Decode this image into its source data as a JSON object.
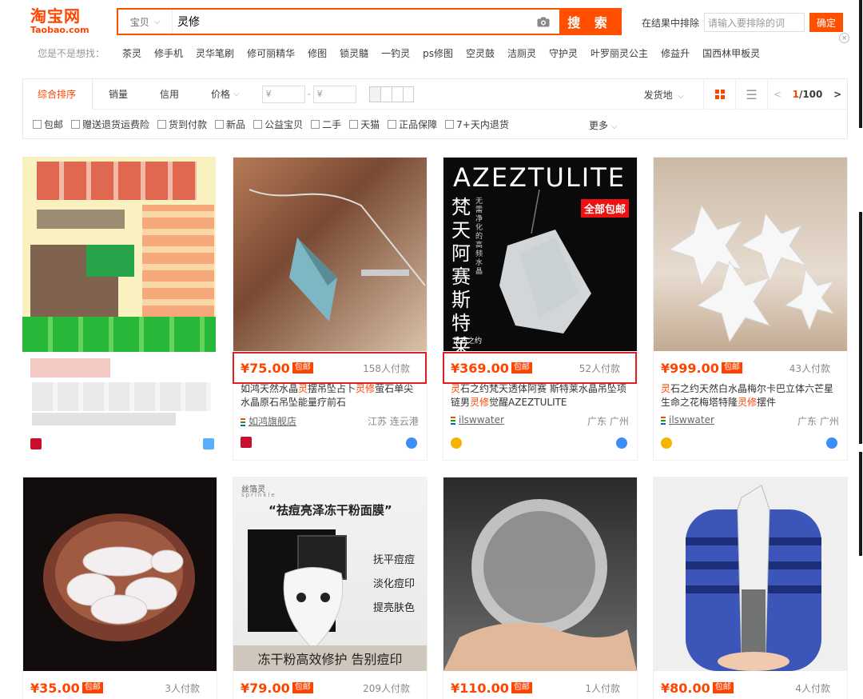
{
  "logo": {
    "cn": "淘宝网",
    "en": "Taobao.com"
  },
  "search": {
    "scope": "宝贝",
    "query": "灵修",
    "button": "搜 索"
  },
  "exclude": {
    "label": "在结果中排除",
    "placeholder": "请输入要排除的词",
    "ok": "确定"
  },
  "suggest": {
    "label": "您是不是想找：",
    "items": [
      "茶灵",
      "修手机",
      "灵华笔刷",
      "修可丽精华",
      "修图",
      "锁灵髓",
      "一钓灵",
      "ps修图",
      "空灵鼓",
      "洁厕灵",
      "守护灵",
      "叶罗丽灵公主",
      "修益升",
      "国西林甲板灵"
    ]
  },
  "sort": {
    "tabs": [
      "综合排序",
      "销量",
      "信用",
      "价格"
    ],
    "price_from": "¥",
    "price_to": "¥",
    "ship_from": "发货地",
    "page_current": "1",
    "page_total": "/100"
  },
  "filters": [
    "包邮",
    "赠送退货运费险",
    "货到付款",
    "新品",
    "公益宝贝",
    "二手",
    "天猫",
    "正品保障",
    "7+天内退货"
  ],
  "more": "更多",
  "products_row1": [
    {
      "price": "",
      "sales": "",
      "title": "",
      "shop": "",
      "loc": ""
    },
    {
      "price": "¥75.00",
      "badge": "包邮",
      "sales": "158人付款",
      "title_a": "如鸿天然水晶",
      "hl1": "灵",
      "title_b": "摆吊坠占卜",
      "hl2": "灵修",
      "title_c": "萤石单尖水晶原石吊坠能量疗前石",
      "shop": "如鸿旗舰店",
      "loc": "江苏 连云港"
    },
    {
      "price": "¥369.00",
      "badge": "包邮",
      "sales": "52人付款",
      "hl1": "灵",
      "title_a": "石之约梵天透体阿赛 斯特莱水晶吊坠项链男",
      "hl2": "灵修",
      "title_b": "觉醒AZEZTULITE",
      "shop": "ilswwater",
      "loc": "广东 广州",
      "img_title": "AZEZTULITE",
      "img_side": "梵天阿赛斯特莱",
      "img_tag": "全部包邮",
      "img_sub": "无需净化的高频水晶",
      "img_brand": "灵石之约"
    },
    {
      "price": "¥999.00",
      "badge": "包邮",
      "sales": "43人付款",
      "hl1": "灵",
      "title_a": "石之约天然白水晶梅尔卡巴立体六芒星生命之花梅塔特隆",
      "hl2": "灵修",
      "title_b": "摆件",
      "shop": "ilswwater",
      "loc": "广东 广州"
    }
  ],
  "products_row2": [
    {
      "price": "¥35.00",
      "badge": "包邮",
      "sales": "3人付款"
    },
    {
      "price": "¥79.00",
      "badge": "包邮",
      "sales": "209人付款",
      "img_brand": "丝箔灵",
      "img_brand_en": "sprinkle",
      "img_title": "“祛痘亮泽冻干粉面膜”",
      "img_points": [
        "抚平痘痘",
        "淡化痘印",
        "提亮肤色"
      ],
      "img_bottom": "冻干粉高效修护 告别痘印"
    },
    {
      "price": "¥110.00",
      "badge": "包邮",
      "sales": "1人付款"
    },
    {
      "price": "¥80.00",
      "badge": "包邮",
      "sales": "4人付款"
    }
  ]
}
